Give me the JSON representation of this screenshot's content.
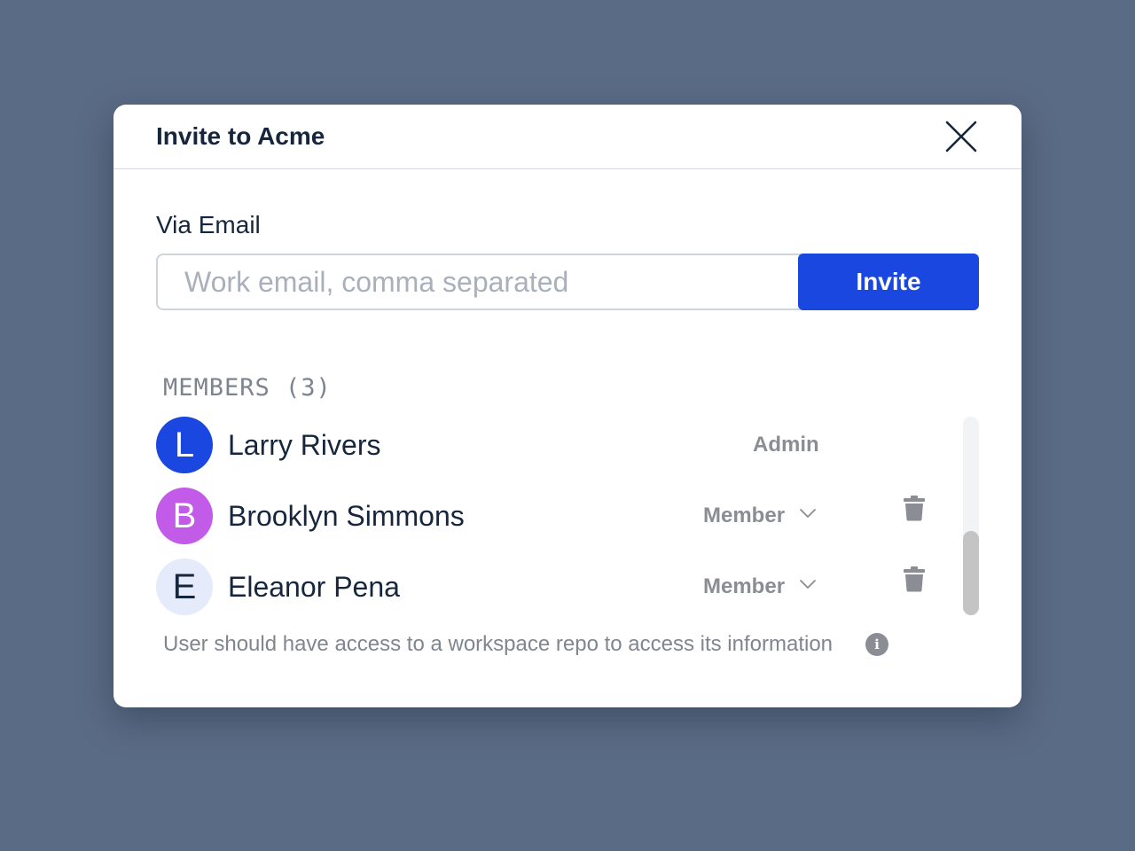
{
  "dialog": {
    "title": "Invite to Acme",
    "close_icon": "close-icon"
  },
  "email": {
    "label": "Via Email",
    "placeholder": "Work email, comma separated",
    "value": "",
    "button_label": "Invite"
  },
  "members": {
    "heading": "MEMBERS (3)",
    "list": [
      {
        "initial": "L",
        "name": "Larry Rivers",
        "role": "Admin",
        "editable": false,
        "avatar_bg": "#1a47e0",
        "avatar_fg": "#ffffff"
      },
      {
        "initial": "B",
        "name": "Brooklyn Simmons",
        "role": "Member",
        "editable": true,
        "avatar_bg": "#c25be8",
        "avatar_fg": "#ffffff"
      },
      {
        "initial": "E",
        "name": "Eleanor Pena",
        "role": "Member",
        "editable": true,
        "avatar_bg": "#e6ebfb",
        "avatar_fg": "#16263d"
      }
    ]
  },
  "note": {
    "text": "User should have access to a workspace repo to access its information",
    "icon": "info-icon",
    "icon_glyph": "i"
  },
  "colors": {
    "backdrop": "#5a6b85",
    "primary": "#1a47e0",
    "title_text": "#16263d",
    "muted_text": "#8a8e94"
  }
}
